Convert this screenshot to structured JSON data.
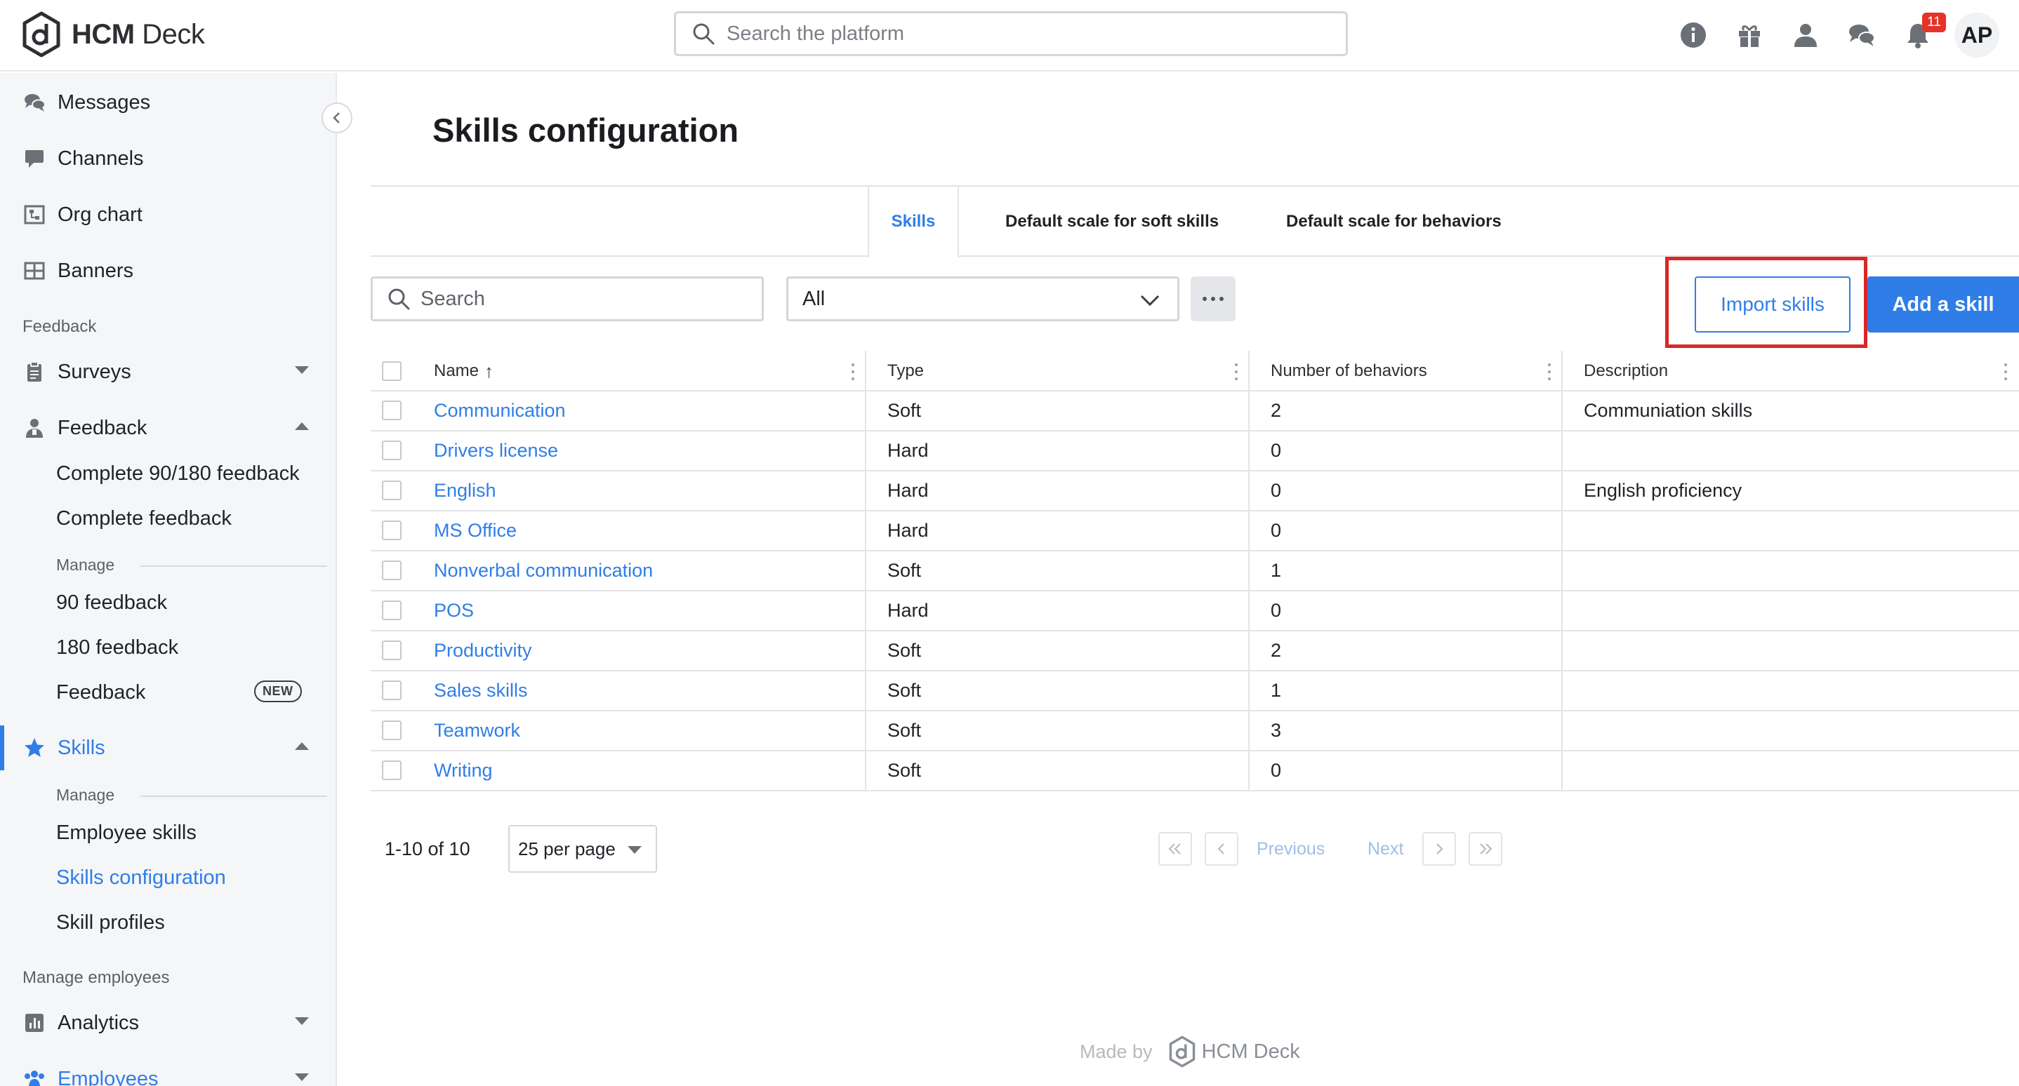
{
  "app": {
    "name_bold": "HCM",
    "name_rest": " Deck"
  },
  "topbar": {
    "search_placeholder": "Search the platform",
    "icons": [
      "info-icon",
      "gift-icon",
      "user-icon",
      "chat-icon",
      "bell-icon"
    ],
    "notification_count": "11",
    "avatar_initials": "AP"
  },
  "sidebar": {
    "items_top": [
      {
        "label": "Messages",
        "icon": "messages-icon"
      },
      {
        "label": "Channels",
        "icon": "channels-icon"
      },
      {
        "label": "Org chart",
        "icon": "org-chart-icon"
      },
      {
        "label": "Banners",
        "icon": "banners-icon"
      }
    ],
    "section_feedback": "Feedback",
    "surveys": "Surveys",
    "feedback": "Feedback",
    "feedback_sub": [
      "Complete 90/180 feedback",
      "Complete feedback"
    ],
    "manage_label": "Manage",
    "feedback_manage": [
      "90 feedback",
      "180 feedback",
      "Feedback"
    ],
    "new_badge": "NEW",
    "skills": "Skills",
    "skills_manage_label": "Manage",
    "skills_sub": [
      "Employee skills",
      "Skills configuration",
      "Skill profiles"
    ],
    "section_manage_employees": "Manage employees",
    "analytics": "Analytics",
    "employees": "Employees"
  },
  "main": {
    "title": "Skills configuration",
    "tabs": [
      "Skills",
      "Default scale for soft skills",
      "Default scale for behaviors"
    ],
    "search_placeholder": "Search",
    "filter_value": "All",
    "import_label": "Import skills",
    "add_label": "Add a skill",
    "columns": [
      "Name",
      "Type",
      "Number of behaviors",
      "Description"
    ],
    "sort_indicator": "↑",
    "rows": [
      {
        "name": "Communication",
        "type": "Soft",
        "behaviors": "2",
        "description": "Communiation skills"
      },
      {
        "name": "Drivers license",
        "type": "Hard",
        "behaviors": "0",
        "description": ""
      },
      {
        "name": "English",
        "type": "Hard",
        "behaviors": "0",
        "description": "English proficiency"
      },
      {
        "name": "MS Office",
        "type": "Hard",
        "behaviors": "0",
        "description": ""
      },
      {
        "name": "Nonverbal communication",
        "type": "Soft",
        "behaviors": "1",
        "description": ""
      },
      {
        "name": "POS",
        "type": "Hard",
        "behaviors": "0",
        "description": ""
      },
      {
        "name": "Productivity",
        "type": "Soft",
        "behaviors": "2",
        "description": ""
      },
      {
        "name": "Sales skills",
        "type": "Soft",
        "behaviors": "1",
        "description": ""
      },
      {
        "name": "Teamwork",
        "type": "Soft",
        "behaviors": "3",
        "description": ""
      },
      {
        "name": "Writing",
        "type": "Soft",
        "behaviors": "0",
        "description": ""
      }
    ],
    "pagination": {
      "range": "1-10 of 10",
      "per_page": "25 per page",
      "previous": "Previous",
      "next": "Next"
    }
  },
  "footer": {
    "made_by": "Made by",
    "brand": "HCM Deck"
  },
  "colors": {
    "accent": "#2f7ee8",
    "highlight": "#dc2626",
    "badge": "#e5332a"
  }
}
